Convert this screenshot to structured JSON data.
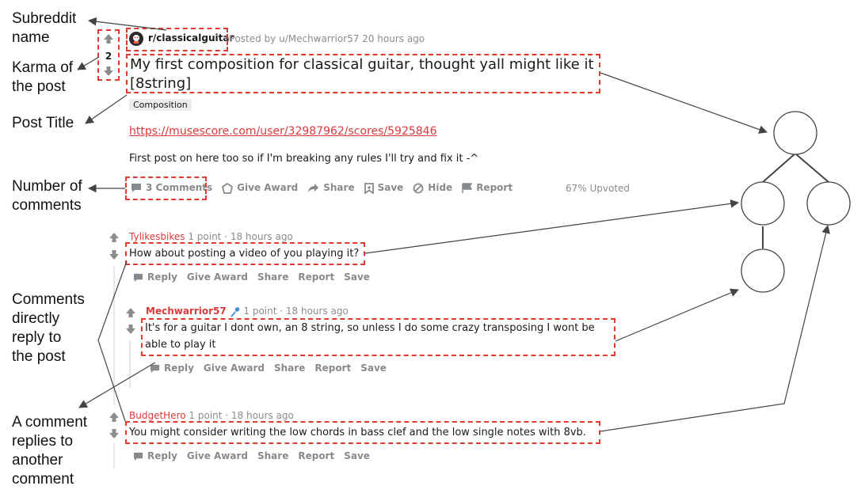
{
  "annotations": {
    "subreddit": "Subreddit\nname",
    "karma": "Karma of\nthe post",
    "title": "Post Title",
    "num_comments": "Number of\ncomments",
    "direct": "Comments\ndirectly\nreply to\nthe post",
    "nested": "A comment\nreplies to\nanother\ncomment"
  },
  "post": {
    "subreddit": "r/classicalguitar",
    "posted_by": "· Posted by u/Mechwarrior57 20 hours ago",
    "score": "2",
    "title": "My first composition for classical guitar, thought yall might like it [8string]",
    "flair": "Composition",
    "link": "https://musescore.com/user/32987962/scores/5925846",
    "body": "First post on here too so if I'm breaking any rules I'll try and fix it -^",
    "actions": {
      "comments": "3 Comments",
      "award": "Give Award",
      "share": "Share",
      "save": "Save",
      "hide": "Hide",
      "report": "Report"
    },
    "upvoted": "67% Upvoted"
  },
  "comment_actions": {
    "reply": "Reply",
    "award": "Give Award",
    "share": "Share",
    "report": "Report",
    "save": "Save"
  },
  "comments": [
    {
      "user": "Tylikesbikes",
      "meta": "1 point · 18 hours ago",
      "text": "How about posting a video of you playing it?"
    },
    {
      "user": "Mechwarrior57",
      "meta": "1 point · 18 hours ago",
      "text": "It's for a guitar I dont own, an 8 string, so unless I do some crazy transposing I wont be able to play it"
    },
    {
      "user": "BudgetHero",
      "meta": "1 point · 18 hours ago",
      "text": "You might consider writing the low chords in bass clef and the low single notes with 8vb."
    }
  ],
  "icons": [
    "upvote-icon",
    "downvote-icon",
    "subreddit-avatar-icon",
    "comment-icon",
    "award-icon",
    "share-icon",
    "save-icon",
    "hide-icon",
    "report-icon",
    "mic-icon"
  ],
  "colors": {
    "annotation_box": "#e03a2f",
    "username": "#d93a3a",
    "link": "#d93a3a",
    "muted": "#878a8c"
  }
}
